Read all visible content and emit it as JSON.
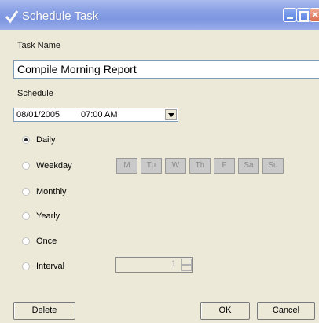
{
  "window": {
    "title": "Schedule Task"
  },
  "task_name": {
    "label": "Task Name",
    "value": "Compile Morning Report"
  },
  "schedule": {
    "label": "Schedule",
    "date": "08/01/2005",
    "time": "07:00 AM"
  },
  "recurrence": {
    "selected": "Daily",
    "options": [
      "Daily",
      "Weekday",
      "Monthly",
      "Yearly",
      "Once",
      "Interval"
    ]
  },
  "weekdays": [
    "M",
    "Tu",
    "W",
    "Th",
    "F",
    "Sa",
    "Su"
  ],
  "interval": {
    "value": "1"
  },
  "buttons": {
    "delete": "Delete",
    "ok": "OK",
    "cancel": "Cancel"
  }
}
